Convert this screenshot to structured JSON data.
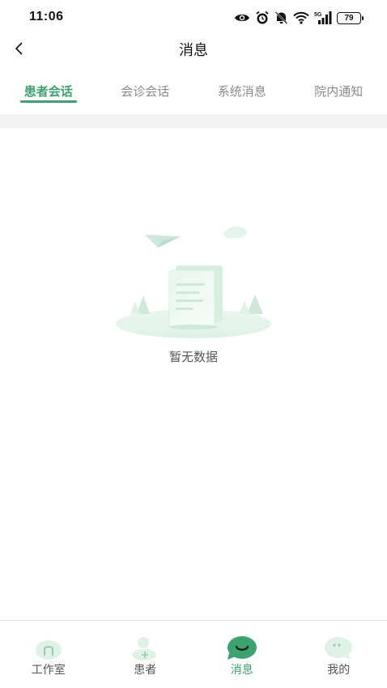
{
  "status_bar": {
    "time": "11:06",
    "network": "5G",
    "battery": "79",
    "icons": [
      "eye-icon",
      "alarm-icon",
      "bell-off-icon",
      "wifi-icon",
      "signal-icon",
      "battery-icon"
    ]
  },
  "header": {
    "back_icon": "chevron-left-icon",
    "title": "消息"
  },
  "tabs": [
    {
      "label": "患者会话",
      "active": true
    },
    {
      "label": "会诊会话",
      "active": false
    },
    {
      "label": "系统消息",
      "active": false
    },
    {
      "label": "院内通知",
      "active": false
    }
  ],
  "empty_state": {
    "illustration": "empty-document-illustration",
    "text": "暂无数据"
  },
  "bottom_nav": [
    {
      "label": "工作室",
      "icon": "studio-icon",
      "active": false
    },
    {
      "label": "患者",
      "icon": "patient-add-icon",
      "active": false
    },
    {
      "label": "消息",
      "icon": "message-icon",
      "active": true
    },
    {
      "label": "我的",
      "icon": "profile-chat-icon",
      "active": false
    }
  ],
  "colors": {
    "accent": "#3aa36e",
    "inactive_text": "#8a8a8a",
    "band": "#f4f4f4"
  }
}
